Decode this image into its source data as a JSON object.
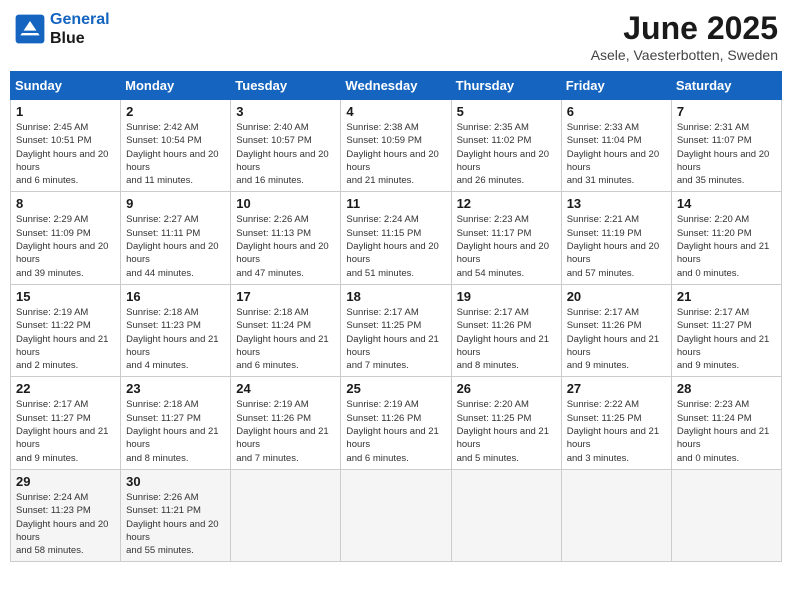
{
  "logo": {
    "line1": "General",
    "line2": "Blue"
  },
  "title": "June 2025",
  "subtitle": "Asele, Vaesterbotten, Sweden",
  "days_of_week": [
    "Sunday",
    "Monday",
    "Tuesday",
    "Wednesday",
    "Thursday",
    "Friday",
    "Saturday"
  ],
  "weeks": [
    [
      {
        "day": "1",
        "sunrise": "2:45 AM",
        "sunset": "10:51 PM",
        "daylight": "20 hours and 6 minutes."
      },
      {
        "day": "2",
        "sunrise": "2:42 AM",
        "sunset": "10:54 PM",
        "daylight": "20 hours and 11 minutes."
      },
      {
        "day": "3",
        "sunrise": "2:40 AM",
        "sunset": "10:57 PM",
        "daylight": "20 hours and 16 minutes."
      },
      {
        "day": "4",
        "sunrise": "2:38 AM",
        "sunset": "10:59 PM",
        "daylight": "20 hours and 21 minutes."
      },
      {
        "day": "5",
        "sunrise": "2:35 AM",
        "sunset": "11:02 PM",
        "daylight": "20 hours and 26 minutes."
      },
      {
        "day": "6",
        "sunrise": "2:33 AM",
        "sunset": "11:04 PM",
        "daylight": "20 hours and 31 minutes."
      },
      {
        "day": "7",
        "sunrise": "2:31 AM",
        "sunset": "11:07 PM",
        "daylight": "20 hours and 35 minutes."
      }
    ],
    [
      {
        "day": "8",
        "sunrise": "2:29 AM",
        "sunset": "11:09 PM",
        "daylight": "20 hours and 39 minutes."
      },
      {
        "day": "9",
        "sunrise": "2:27 AM",
        "sunset": "11:11 PM",
        "daylight": "20 hours and 44 minutes."
      },
      {
        "day": "10",
        "sunrise": "2:26 AM",
        "sunset": "11:13 PM",
        "daylight": "20 hours and 47 minutes."
      },
      {
        "day": "11",
        "sunrise": "2:24 AM",
        "sunset": "11:15 PM",
        "daylight": "20 hours and 51 minutes."
      },
      {
        "day": "12",
        "sunrise": "2:23 AM",
        "sunset": "11:17 PM",
        "daylight": "20 hours and 54 minutes."
      },
      {
        "day": "13",
        "sunrise": "2:21 AM",
        "sunset": "11:19 PM",
        "daylight": "20 hours and 57 minutes."
      },
      {
        "day": "14",
        "sunrise": "2:20 AM",
        "sunset": "11:20 PM",
        "daylight": "21 hours and 0 minutes."
      }
    ],
    [
      {
        "day": "15",
        "sunrise": "2:19 AM",
        "sunset": "11:22 PM",
        "daylight": "21 hours and 2 minutes."
      },
      {
        "day": "16",
        "sunrise": "2:18 AM",
        "sunset": "11:23 PM",
        "daylight": "21 hours and 4 minutes."
      },
      {
        "day": "17",
        "sunrise": "2:18 AM",
        "sunset": "11:24 PM",
        "daylight": "21 hours and 6 minutes."
      },
      {
        "day": "18",
        "sunrise": "2:17 AM",
        "sunset": "11:25 PM",
        "daylight": "21 hours and 7 minutes."
      },
      {
        "day": "19",
        "sunrise": "2:17 AM",
        "sunset": "11:26 PM",
        "daylight": "21 hours and 8 minutes."
      },
      {
        "day": "20",
        "sunrise": "2:17 AM",
        "sunset": "11:26 PM",
        "daylight": "21 hours and 9 minutes."
      },
      {
        "day": "21",
        "sunrise": "2:17 AM",
        "sunset": "11:27 PM",
        "daylight": "21 hours and 9 minutes."
      }
    ],
    [
      {
        "day": "22",
        "sunrise": "2:17 AM",
        "sunset": "11:27 PM",
        "daylight": "21 hours and 9 minutes."
      },
      {
        "day": "23",
        "sunrise": "2:18 AM",
        "sunset": "11:27 PM",
        "daylight": "21 hours and 8 minutes."
      },
      {
        "day": "24",
        "sunrise": "2:19 AM",
        "sunset": "11:26 PM",
        "daylight": "21 hours and 7 minutes."
      },
      {
        "day": "25",
        "sunrise": "2:19 AM",
        "sunset": "11:26 PM",
        "daylight": "21 hours and 6 minutes."
      },
      {
        "day": "26",
        "sunrise": "2:20 AM",
        "sunset": "11:25 PM",
        "daylight": "21 hours and 5 minutes."
      },
      {
        "day": "27",
        "sunrise": "2:22 AM",
        "sunset": "11:25 PM",
        "daylight": "21 hours and 3 minutes."
      },
      {
        "day": "28",
        "sunrise": "2:23 AM",
        "sunset": "11:24 PM",
        "daylight": "21 hours and 0 minutes."
      }
    ],
    [
      {
        "day": "29",
        "sunrise": "2:24 AM",
        "sunset": "11:23 PM",
        "daylight": "20 hours and 58 minutes."
      },
      {
        "day": "30",
        "sunrise": "2:26 AM",
        "sunset": "11:21 PM",
        "daylight": "20 hours and 55 minutes."
      },
      null,
      null,
      null,
      null,
      null
    ]
  ]
}
